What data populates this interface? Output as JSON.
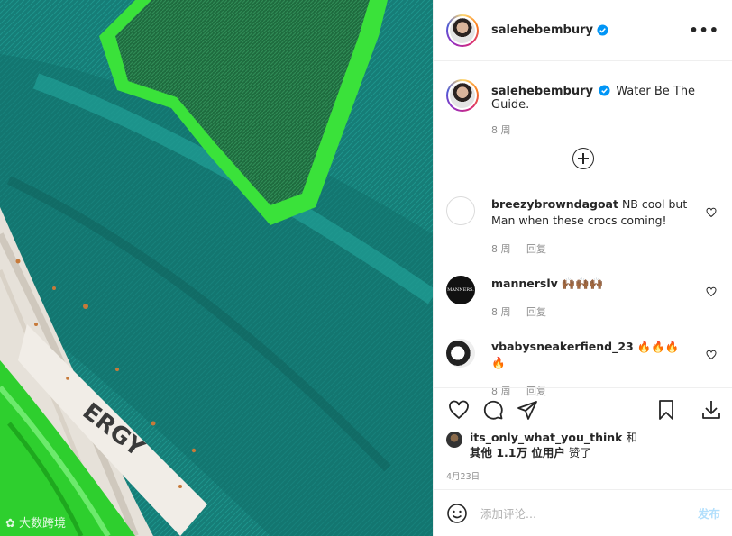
{
  "post": {
    "username": "salehebembury",
    "more_label": "•••",
    "caption_text": "Water Be The Guide.",
    "caption_time": "8 周"
  },
  "comments": [
    {
      "user": "breezybrowndagoat",
      "text": "NB cool but Man when these crocs coming!",
      "time": "8 周",
      "reply": "回复"
    },
    {
      "user": "mannerslv",
      "text": "🙌🏾🙌🏾🙌🏾",
      "time": "8 周",
      "reply": "回复",
      "avatar_text": "MANNERS."
    },
    {
      "user": "vbabysneakerfiend_23",
      "text": "🔥🔥🔥🔥",
      "time": "8 周",
      "reply": "回复"
    }
  ],
  "likes": {
    "user": "its_only_what_you_think",
    "mid": " 和",
    "others": "其他 1.1万 位用户",
    "suffix": " 赞了"
  },
  "date": "4月23日",
  "add_comment": {
    "placeholder": "添加评论...",
    "post_label": "发布"
  },
  "watermark": "大数跨境",
  "colors": {
    "verified": "#0095f6",
    "photo_teal": "#157a74",
    "neon_green": "#39e639",
    "post_disabled": "#b2dffc"
  },
  "icons": [
    "ellipsis-icon",
    "verified-badge-icon",
    "plus-circle-icon",
    "heart-icon",
    "comment-icon",
    "share-icon",
    "bookmark-icon",
    "download-icon",
    "smiley-icon"
  ]
}
